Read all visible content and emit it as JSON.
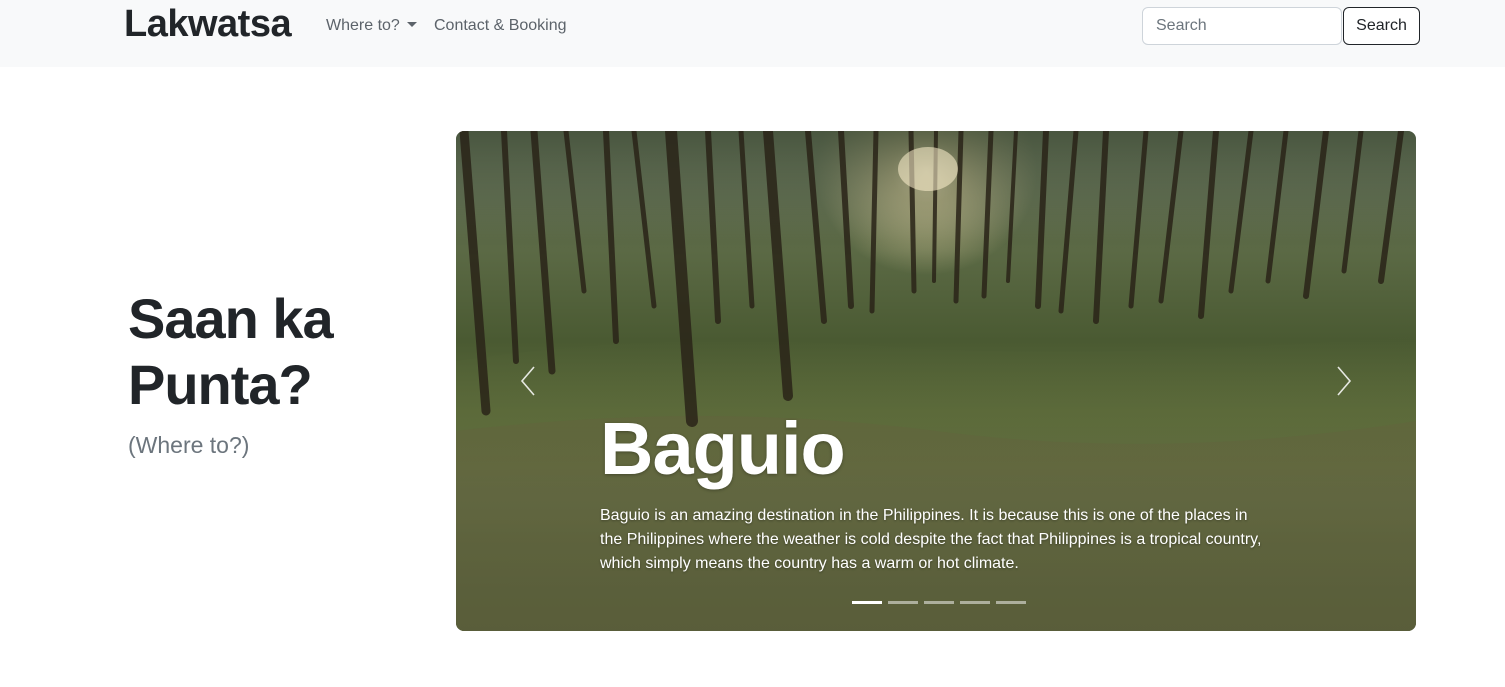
{
  "navbar": {
    "brand": "Lakwatsa",
    "links": [
      {
        "label": "Where to?",
        "dropdown": true
      },
      {
        "label": "Contact & Booking",
        "dropdown": false
      }
    ],
    "search": {
      "placeholder": "Search",
      "button_label": "Search"
    }
  },
  "hero": {
    "title": "Saan ka Punta?",
    "subtitle": "(Where to?)"
  },
  "carousel": {
    "slide_title": "Baguio",
    "slide_text": "Baguio is an amazing destination in the Philippines. It is because this is one of the places in the Philippines where the weather is cold despite the fact that Philippines is a tropical country, which simply means the country has a warm or hot climate.",
    "slide_count": 5,
    "active_slide": 0
  },
  "colors": {
    "navbar_bg": "#f8f9fa",
    "text_dark": "#212529",
    "text_muted": "#6c757d"
  }
}
